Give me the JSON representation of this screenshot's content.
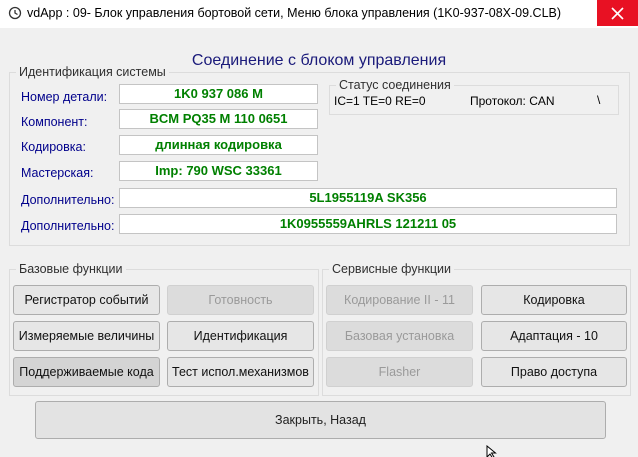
{
  "window": {
    "title": "vdApp : 09- Блок управления бортовой сети,  Меню блока управления (1K0-937-08X-09.CLB)",
    "close_glyph": "✕"
  },
  "heading": "Соединение с блоком управления",
  "identification": {
    "group_label": "Идентификация системы",
    "fields": [
      {
        "label": "Номер детали:",
        "value": "1K0 937 086 M"
      },
      {
        "label": "Компонент:",
        "value": "BCM PQ35  M    110 0651"
      },
      {
        "label": "Кодировка:",
        "value": "длинная кодировка"
      },
      {
        "label": "Мастерская:",
        "value": "Imp: 790     WSC 33361"
      },
      {
        "label": "Дополнительно:",
        "value": "5L1955119A SK356"
      },
      {
        "label": "Дополнительно:",
        "value": "1K0955559AHRLS 121211 05"
      }
    ]
  },
  "connection_status": {
    "group_label": "Статус соединения",
    "status_line": "IC=1  TE=0   RE=0",
    "protocol": "Протокол: CAN",
    "spinner": "\\"
  },
  "basic_functions": {
    "group_label": "Базовые функции",
    "buttons": [
      {
        "label": "Регистратор событий",
        "enabled": true
      },
      {
        "label": "Готовность",
        "enabled": false
      },
      {
        "label": "Измеряемые величины",
        "enabled": true
      },
      {
        "label": "Идентификация",
        "enabled": true
      },
      {
        "label": "Поддерживаемые кода",
        "enabled": true
      },
      {
        "label": "Тест испол.механизмов",
        "enabled": true
      }
    ]
  },
  "service_functions": {
    "group_label": "Сервисные функции",
    "buttons": [
      {
        "label": "Кодирование II - 11",
        "enabled": false
      },
      {
        "label": "Кодировка",
        "enabled": true
      },
      {
        "label": "Базовая установка",
        "enabled": false
      },
      {
        "label": "Адаптация - 10",
        "enabled": true
      },
      {
        "label": "Flasher",
        "enabled": false
      },
      {
        "label": "Право доступа",
        "enabled": true
      }
    ]
  },
  "close_button": "Закрыть, Назад",
  "colors": {
    "heading": "#1a1a7a",
    "label": "#00008b",
    "value": "#008000",
    "close_button_bg": "#e81123",
    "window_bg": "#f0f0f0"
  }
}
